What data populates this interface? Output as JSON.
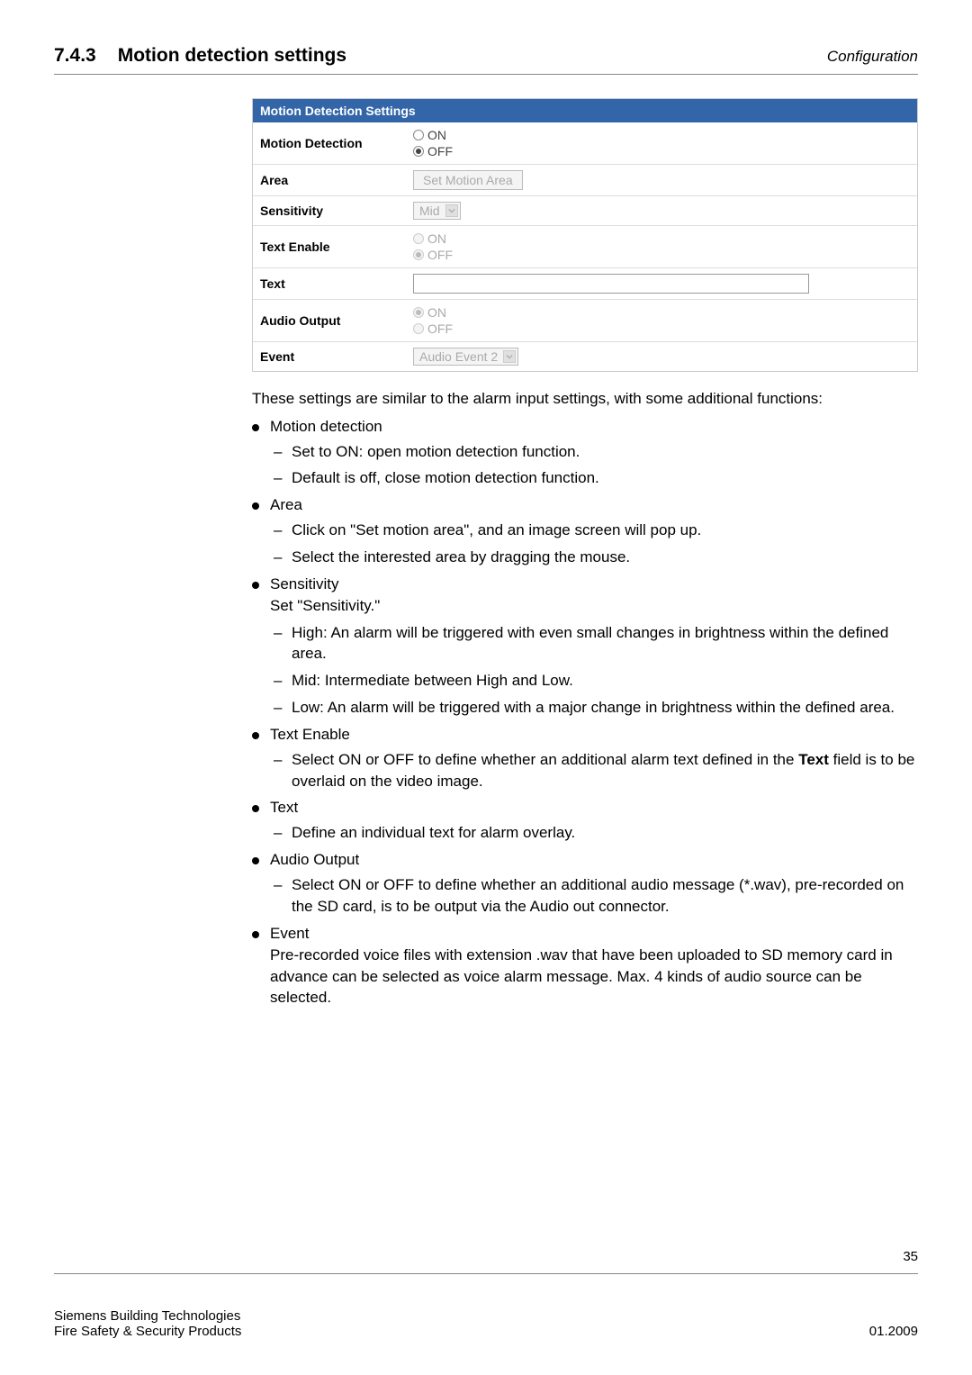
{
  "header": {
    "config_label": "Configuration",
    "section_number": "7.4.3",
    "section_title": "Motion detection settings"
  },
  "panel": {
    "title": "Motion Detection Settings",
    "rows": {
      "motion_detection": {
        "label": "Motion Detection",
        "on": "ON",
        "off": "OFF"
      },
      "area": {
        "label": "Area",
        "button": "Set Motion Area"
      },
      "sensitivity": {
        "label": "Sensitivity",
        "value": "Mid"
      },
      "text_enable": {
        "label": "Text Enable",
        "on": "ON",
        "off": "OFF"
      },
      "text": {
        "label": "Text"
      },
      "audio_output": {
        "label": "Audio Output",
        "on": "ON",
        "off": "OFF"
      },
      "event": {
        "label": "Event",
        "value": "Audio Event 2"
      }
    }
  },
  "intro": "These settings are similar to the alarm input settings, with some additional functions:",
  "list": {
    "motion_detection": {
      "title": "Motion detection",
      "sub1": "Set to ON: open motion detection function.",
      "sub2": "Default is off, close motion detection function."
    },
    "area": {
      "title": "Area",
      "sub1": "Click on \"Set motion area\", and an image screen will pop up.",
      "sub2": "Select the interested area by dragging the mouse."
    },
    "sensitivity": {
      "title": "Sensitivity",
      "desc": "Set \"Sensitivity.\"",
      "sub1": "High: An alarm will be triggered with even small changes in brightness within the defined area.",
      "sub2": "Mid: Intermediate between High and Low.",
      "sub3": "Low: An alarm will be triggered with a major change in brightness within the defined area."
    },
    "text_enable": {
      "title": "Text Enable",
      "sub1_pre": "Select ON or OFF to define whether an additional alarm text defined in the ",
      "sub1_bold": "Text",
      "sub1_post": " field is to be overlaid on the video image."
    },
    "text": {
      "title": "Text",
      "sub1": "Define an individual text for alarm overlay."
    },
    "audio_output": {
      "title": "Audio Output",
      "sub1": "Select ON or OFF to define whether an additional audio message (*.wav), pre-recorded on the SD card, is to be output via the Audio out connector."
    },
    "event": {
      "title": "Event",
      "desc": "Pre-recorded voice files with extension .wav that have been uploaded to SD memory card in advance can be selected as voice alarm message. Max. 4 kinds of audio source can be selected."
    }
  },
  "footer": {
    "page": "35",
    "left1": "Siemens Building Technologies",
    "left2": "Fire Safety & Security Products",
    "right": "01.2009"
  }
}
